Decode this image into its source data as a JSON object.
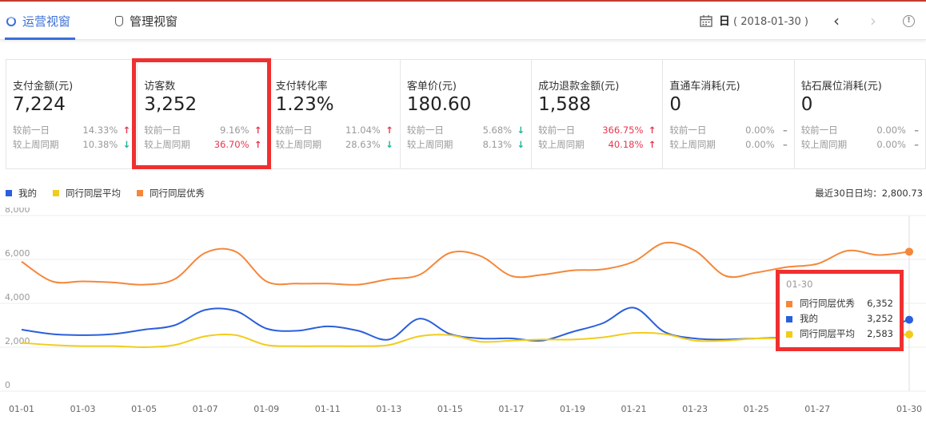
{
  "tabs": [
    {
      "label": "运营视窗",
      "icon": "refresh-circle-icon",
      "active": true
    },
    {
      "label": "管理视窗",
      "icon": "bag-icon",
      "active": false
    }
  ],
  "date": {
    "period": "日",
    "value": "( 2018-01-30 )"
  },
  "cards": [
    {
      "title": "支付金额(元)",
      "value": "7,224",
      "day_label": "较前一日",
      "day_pct": "14.33%",
      "day_dir": "up",
      "week_label": "较上周同期",
      "week_pct": "10.38%",
      "week_dir": "down"
    },
    {
      "title": "访客数",
      "value": "3,252",
      "day_label": "较前一日",
      "day_pct": "9.16%",
      "day_dir": "up",
      "week_label": "较上周同期",
      "week_pct": "36.70%",
      "week_dir": "up",
      "week_red": true
    },
    {
      "title": "支付转化率",
      "value": "1.23%",
      "day_label": "较前一日",
      "day_pct": "11.04%",
      "day_dir": "up",
      "week_label": "较上周同期",
      "week_pct": "28.63%",
      "week_dir": "down"
    },
    {
      "title": "客单价(元)",
      "value": "180.60",
      "day_label": "较前一日",
      "day_pct": "5.68%",
      "day_dir": "down",
      "week_label": "较上周同期",
      "week_pct": "8.13%",
      "week_dir": "down"
    },
    {
      "title": "成功退款金额(元)",
      "value": "1,588",
      "day_label": "较前一日",
      "day_pct": "366.75%",
      "day_dir": "up",
      "day_red": true,
      "week_label": "较上周同期",
      "week_pct": "40.18%",
      "week_dir": "up",
      "week_red": true
    },
    {
      "title": "直通车消耗(元)",
      "value": "0",
      "day_label": "较前一日",
      "day_pct": "0.00%",
      "day_dir": "flat",
      "week_label": "较上周同期",
      "week_pct": "0.00%",
      "week_dir": "flat"
    },
    {
      "title": "钻石展位消耗(元)",
      "value": "0",
      "day_label": "较前一日",
      "day_pct": "0.00%",
      "day_dir": "flat",
      "week_label": "较上周同期",
      "week_pct": "0.00%",
      "week_dir": "flat"
    }
  ],
  "avg_text": "最近30日日均：2,800.73",
  "colors": {
    "mine": "#2a5fdc",
    "avg": "#f2cc1b",
    "best": "#f5873a",
    "accent": "#3a6fd8"
  },
  "chart_data": {
    "type": "line",
    "x": [
      "01-01",
      "01-02",
      "01-03",
      "01-04",
      "01-05",
      "01-06",
      "01-07",
      "01-08",
      "01-09",
      "01-10",
      "01-11",
      "01-12",
      "01-13",
      "01-14",
      "01-15",
      "01-16",
      "01-17",
      "01-18",
      "01-19",
      "01-20",
      "01-21",
      "01-22",
      "01-23",
      "01-24",
      "01-25",
      "01-26",
      "01-27",
      "01-28",
      "01-29",
      "01-30"
    ],
    "xticks": [
      "01-01",
      "01-03",
      "01-05",
      "01-07",
      "01-09",
      "01-11",
      "01-13",
      "01-15",
      "01-17",
      "01-19",
      "01-21",
      "01-23",
      "01-25",
      "01-27",
      "01-30"
    ],
    "yticks": [
      "0",
      "2,000",
      "4,000",
      "6,000",
      "8,000"
    ],
    "ylim": [
      0,
      8000
    ],
    "series": [
      {
        "name": "我的",
        "color": "#2a5fdc",
        "values": [
          2800,
          2600,
          2550,
          2600,
          2800,
          3000,
          3700,
          3650,
          2850,
          2750,
          2950,
          2750,
          2350,
          3300,
          2600,
          2400,
          2400,
          2300,
          2700,
          3100,
          3800,
          2700,
          2400,
          2350,
          2400,
          2400,
          2050,
          2500,
          2800,
          3252
        ]
      },
      {
        "name": "同行同层平均",
        "color": "#f2cc1b",
        "values": [
          2200,
          2100,
          2050,
          2050,
          2000,
          2100,
          2500,
          2550,
          2100,
          2050,
          2050,
          2050,
          2100,
          2500,
          2550,
          2250,
          2300,
          2350,
          2350,
          2450,
          2650,
          2600,
          2300,
          2300,
          2400,
          2400,
          2400,
          2450,
          2500,
          2583
        ]
      },
      {
        "name": "同行同层优秀",
        "color": "#f5873a",
        "values": [
          5900,
          5000,
          5000,
          4950,
          4850,
          5100,
          6300,
          6350,
          5000,
          4900,
          4900,
          4850,
          5100,
          5300,
          6300,
          6150,
          5250,
          5300,
          5500,
          5550,
          5900,
          6750,
          6400,
          5250,
          5400,
          5650,
          5800,
          6400,
          6200,
          6352
        ]
      }
    ],
    "legend_order": [
      0,
      1,
      2
    ],
    "tooltip": {
      "date": "01-30",
      "rows": [
        {
          "name": "同行同层优秀",
          "value": "6,352",
          "color": "#f5873a"
        },
        {
          "name": "我的",
          "value": "3,252",
          "color": "#2a5fdc"
        },
        {
          "name": "同行同层平均",
          "value": "2,583",
          "color": "#f2cc1b"
        }
      ]
    }
  }
}
